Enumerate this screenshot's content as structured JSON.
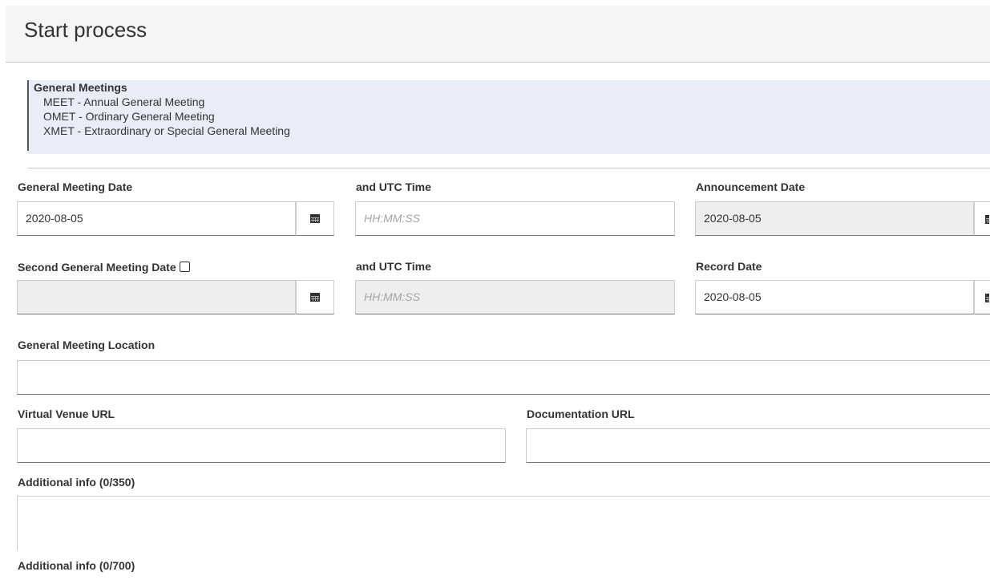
{
  "header": {
    "title": "Start process"
  },
  "info": {
    "group": "General Meetings",
    "items": [
      "MEET - Annual General Meeting",
      "OMET - Ordinary General Meeting",
      "XMET - Extraordinary or Special General Meeting"
    ]
  },
  "form": {
    "gm_date": {
      "label": "General Meeting Date",
      "value": "2020-08-05"
    },
    "utc_time_1": {
      "label": "and UTC Time",
      "placeholder": "HH:MM:SS"
    },
    "announcement_date": {
      "label": "Announcement Date",
      "value": "2020-08-05"
    },
    "second_gm_date": {
      "label": "Second General Meeting Date",
      "value": "",
      "checked": false
    },
    "utc_time_2": {
      "label": "and UTC Time",
      "placeholder": "HH:MM:SS"
    },
    "record_date": {
      "label": "Record Date",
      "value": "2020-08-05"
    },
    "location": {
      "label": "General Meeting Location",
      "value": ""
    },
    "virtual_venue_url": {
      "label": "Virtual Venue URL",
      "value": ""
    },
    "documentation_url": {
      "label": "Documentation URL",
      "value": ""
    },
    "additional_info_1": {
      "label": "Additional info (0/350)",
      "value": ""
    },
    "additional_info_2": {
      "label": "Additional info (0/700)"
    }
  },
  "icons": {
    "calendar": "calendar-icon"
  }
}
